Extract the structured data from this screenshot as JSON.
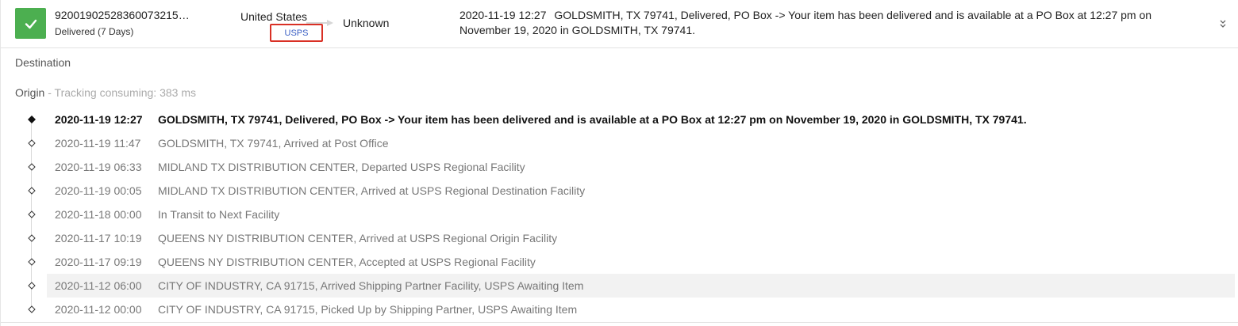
{
  "shipment": {
    "tracking_number": "92001902528360073215…",
    "status": "Delivered (7 Days)",
    "status_color": "#4caf50",
    "origin_country": "United States",
    "carrier": "USPS",
    "destination_country": "Unknown",
    "latest_event": {
      "time": "2020-11-19 12:27",
      "text": "GOLDSMITH, TX 79741, Delivered, PO Box -> Your item has been delivered and is available at a PO Box at 12:27 pm on November 19, 2020 in GOLDSMITH, TX 79741."
    }
  },
  "sections": {
    "destination_label": "Destination",
    "origin_label": "Origin",
    "origin_note": " - Tracking consuming: 383 ms"
  },
  "events": [
    {
      "time": "2020-11-19 12:27",
      "desc": "GOLDSMITH, TX 79741, Delivered, PO Box -> Your item has been delivered and is available at a PO Box at 12:27 pm on November 19, 2020 in GOLDSMITH, TX 79741."
    },
    {
      "time": "2020-11-19 11:47",
      "desc": "GOLDSMITH, TX 79741, Arrived at Post Office"
    },
    {
      "time": "2020-11-19 06:33",
      "desc": "MIDLAND TX DISTRIBUTION CENTER, Departed USPS Regional Facility"
    },
    {
      "time": "2020-11-19 00:05",
      "desc": "MIDLAND TX DISTRIBUTION CENTER, Arrived at USPS Regional Destination Facility"
    },
    {
      "time": "2020-11-18 00:00",
      "desc": "In Transit to Next Facility"
    },
    {
      "time": "2020-11-17 10:19",
      "desc": "QUEENS NY DISTRIBUTION CENTER, Arrived at USPS Regional Origin Facility"
    },
    {
      "time": "2020-11-17 09:19",
      "desc": "QUEENS NY DISTRIBUTION CENTER, Accepted at USPS Regional Facility"
    },
    {
      "time": "2020-11-12 06:00",
      "desc": "CITY OF INDUSTRY, CA 91715, Arrived Shipping Partner Facility, USPS Awaiting Item"
    },
    {
      "time": "2020-11-12 00:00",
      "desc": "CITY OF INDUSTRY, CA 91715, Picked Up by Shipping Partner, USPS Awaiting Item"
    }
  ],
  "icons": {
    "status": "checkmark-icon",
    "current_event": "filled-diamond-icon",
    "past_event": "hollow-diamond-icon",
    "expand": "chevron-down-icon"
  }
}
